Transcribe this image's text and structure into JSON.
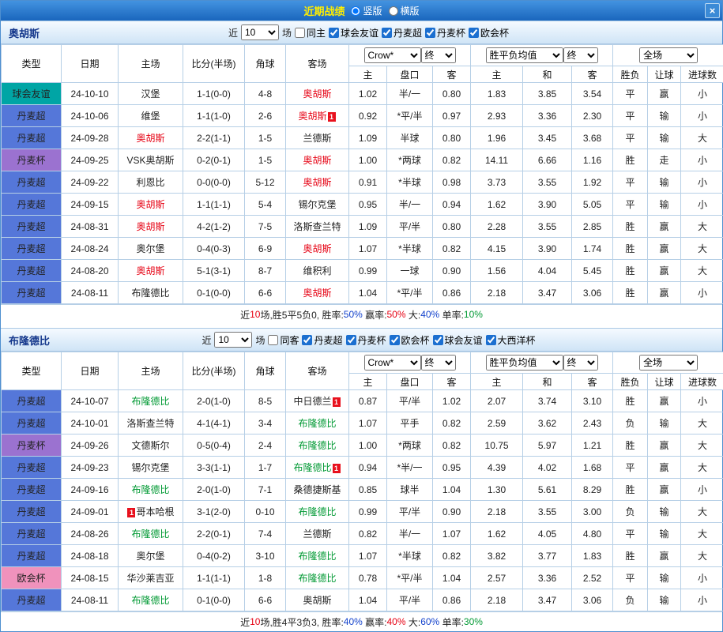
{
  "titlebar": {
    "title": "近期战绩",
    "options": [
      {
        "label": "竖版",
        "selected": true
      },
      {
        "label": "横版",
        "selected": false
      }
    ],
    "close": "×"
  },
  "table_header": {
    "main_cols": [
      "类型",
      "日期",
      "主场",
      "比分(半场)",
      "角球",
      "客场"
    ],
    "sub_cols": [
      "主",
      "盘口",
      "客",
      "主",
      "和",
      "客",
      "胜负",
      "让球",
      "进球数"
    ],
    "odds_company": "Crow*",
    "final_label": "终",
    "avg_label": "胜平负均值",
    "scope_label": "全场"
  },
  "value_colors": {
    "胜": "red",
    "平": "blue",
    "负": "green",
    "赢": "red",
    "输": "green",
    "走": "blue",
    "大": "red",
    "小": "green"
  },
  "league_colors": {
    "球会友谊": "#00a5a5",
    "丹麦超": "#5577d9",
    "丹麦杯": "#9b72d0",
    "欧会杯": "#f092bc",
    "大西洋杯": "#5577d9"
  },
  "sections": [
    {
      "team": "奥胡斯",
      "focus_color": "#e60012",
      "filter": {
        "near_label": "近",
        "count": "10",
        "games_label": "场",
        "same_label": "同主",
        "leagues": [
          "球会友谊",
          "丹麦超",
          "丹麦杯",
          "欧会杯"
        ]
      },
      "rows": [
        {
          "league": "球会友谊",
          "date": "24-10-10",
          "home": {
            "name": "汉堡"
          },
          "score": "1-1(0-0)",
          "corners": "4-8",
          "away": {
            "name": "奥胡斯",
            "focus": true
          },
          "odds": [
            "1.02",
            "半/一",
            "0.80"
          ],
          "avg": [
            "1.83",
            "3.85",
            "3.54"
          ],
          "result": "平",
          "handicap_result": "赢",
          "goals": "小"
        },
        {
          "league": "丹麦超",
          "date": "24-10-06",
          "home": {
            "name": "维堡"
          },
          "score": "1-1(1-0)",
          "corners": "2-6",
          "away": {
            "name": "奥胡斯",
            "focus": true,
            "badge": "1"
          },
          "odds": [
            "0.92",
            "*平/半",
            "0.97"
          ],
          "avg": [
            "2.93",
            "3.36",
            "2.30"
          ],
          "result": "平",
          "handicap_result": "输",
          "goals": "小"
        },
        {
          "league": "丹麦超",
          "date": "24-09-28",
          "home": {
            "name": "奥胡斯",
            "focus": true
          },
          "score": "2-2(1-1)",
          "corners": "1-5",
          "away": {
            "name": "兰德斯"
          },
          "odds": [
            "1.09",
            "半球",
            "0.80"
          ],
          "avg": [
            "1.96",
            "3.45",
            "3.68"
          ],
          "result": "平",
          "handicap_result": "输",
          "goals": "大"
        },
        {
          "league": "丹麦杯",
          "date": "24-09-25",
          "home": {
            "name": "VSK奥胡斯"
          },
          "score": "0-2(0-1)",
          "corners": "1-5",
          "away": {
            "name": "奥胡斯",
            "focus": true
          },
          "odds": [
            "1.00",
            "*两球",
            "0.82"
          ],
          "avg": [
            "14.11",
            "6.66",
            "1.16"
          ],
          "result": "胜",
          "handicap_result": "走",
          "goals": "小"
        },
        {
          "league": "丹麦超",
          "date": "24-09-22",
          "home": {
            "name": "利恩比"
          },
          "score": "0-0(0-0)",
          "corners": "5-12",
          "away": {
            "name": "奥胡斯",
            "focus": true
          },
          "odds": [
            "0.91",
            "*半球",
            "0.98"
          ],
          "avg": [
            "3.73",
            "3.55",
            "1.92"
          ],
          "result": "平",
          "handicap_result": "输",
          "goals": "小"
        },
        {
          "league": "丹麦超",
          "date": "24-09-15",
          "home": {
            "name": "奥胡斯",
            "focus": true
          },
          "score": "1-1(1-1)",
          "corners": "5-4",
          "away": {
            "name": "锡尔克堡"
          },
          "odds": [
            "0.95",
            "半/一",
            "0.94"
          ],
          "avg": [
            "1.62",
            "3.90",
            "5.05"
          ],
          "result": "平",
          "handicap_result": "输",
          "goals": "小"
        },
        {
          "league": "丹麦超",
          "date": "24-08-31",
          "home": {
            "name": "奥胡斯",
            "focus": true
          },
          "score": "4-2(1-2)",
          "corners": "7-5",
          "away": {
            "name": "洛斯查兰特"
          },
          "odds": [
            "1.09",
            "平/半",
            "0.80"
          ],
          "avg": [
            "2.28",
            "3.55",
            "2.85"
          ],
          "result": "胜",
          "handicap_result": "赢",
          "goals": "大"
        },
        {
          "league": "丹麦超",
          "date": "24-08-24",
          "home": {
            "name": "奥尔堡"
          },
          "score": "0-4(0-3)",
          "corners": "6-9",
          "away": {
            "name": "奥胡斯",
            "focus": true
          },
          "odds": [
            "1.07",
            "*半球",
            "0.82"
          ],
          "avg": [
            "4.15",
            "3.90",
            "1.74"
          ],
          "result": "胜",
          "handicap_result": "赢",
          "goals": "大"
        },
        {
          "league": "丹麦超",
          "date": "24-08-20",
          "home": {
            "name": "奥胡斯",
            "focus": true
          },
          "score": "5-1(3-1)",
          "corners": "8-7",
          "away": {
            "name": "维积利"
          },
          "odds": [
            "0.99",
            "一球",
            "0.90"
          ],
          "avg": [
            "1.56",
            "4.04",
            "5.45"
          ],
          "result": "胜",
          "handicap_result": "赢",
          "goals": "大"
        },
        {
          "league": "丹麦超",
          "date": "24-08-11",
          "home": {
            "name": "布隆德比"
          },
          "score": "0-1(0-0)",
          "corners": "6-6",
          "away": {
            "name": "奥胡斯",
            "focus": true
          },
          "odds": [
            "1.04",
            "*平/半",
            "0.86"
          ],
          "avg": [
            "2.18",
            "3.47",
            "3.06"
          ],
          "result": "胜",
          "handicap_result": "赢",
          "goals": "小"
        }
      ],
      "summary": [
        {
          "text": "近",
          "color": "black"
        },
        {
          "text": "10",
          "color": "red"
        },
        {
          "text": "场,胜5平5负0, 胜率:",
          "color": "black"
        },
        {
          "text": "50%",
          "color": "blue"
        },
        {
          "text": " 赢率:",
          "color": "black"
        },
        {
          "text": "50%",
          "color": "red"
        },
        {
          "text": " 大:",
          "color": "black"
        },
        {
          "text": "40%",
          "color": "blue"
        },
        {
          "text": " 单率:",
          "color": "black"
        },
        {
          "text": "10%",
          "color": "green"
        }
      ]
    },
    {
      "team": "布隆德比",
      "focus_color": "#009933",
      "filter": {
        "near_label": "近",
        "count": "10",
        "games_label": "场",
        "same_label": "同客",
        "leagues": [
          "丹麦超",
          "丹麦杯",
          "欧会杯",
          "球会友谊",
          "大西洋杯"
        ]
      },
      "rows": [
        {
          "league": "丹麦超",
          "date": "24-10-07",
          "home": {
            "name": "布隆德比",
            "focus": true
          },
          "score": "2-0(1-0)",
          "corners": "8-5",
          "away": {
            "name": "中日德兰",
            "badge": "1"
          },
          "odds": [
            "0.87",
            "平/半",
            "1.02"
          ],
          "avg": [
            "2.07",
            "3.74",
            "3.10"
          ],
          "result": "胜",
          "handicap_result": "赢",
          "goals": "小"
        },
        {
          "league": "丹麦超",
          "date": "24-10-01",
          "home": {
            "name": "洛斯查兰特"
          },
          "score": "4-1(4-1)",
          "corners": "3-4",
          "away": {
            "name": "布隆德比",
            "focus": true
          },
          "odds": [
            "1.07",
            "平手",
            "0.82"
          ],
          "avg": [
            "2.59",
            "3.62",
            "2.43"
          ],
          "result": "负",
          "handicap_result": "输",
          "goals": "大"
        },
        {
          "league": "丹麦杯",
          "date": "24-09-26",
          "home": {
            "name": "文德斯尔"
          },
          "score": "0-5(0-4)",
          "corners": "2-4",
          "away": {
            "name": "布隆德比",
            "focus": true
          },
          "odds": [
            "1.00",
            "*两球",
            "0.82"
          ],
          "avg": [
            "10.75",
            "5.97",
            "1.21"
          ],
          "result": "胜",
          "handicap_result": "赢",
          "goals": "大"
        },
        {
          "league": "丹麦超",
          "date": "24-09-23",
          "home": {
            "name": "锡尔克堡"
          },
          "score": "3-3(1-1)",
          "corners": "1-7",
          "away": {
            "name": "布隆德比",
            "focus": true,
            "badge": "1"
          },
          "odds": [
            "0.94",
            "*半/一",
            "0.95"
          ],
          "avg": [
            "4.39",
            "4.02",
            "1.68"
          ],
          "result": "平",
          "handicap_result": "赢",
          "goals": "大"
        },
        {
          "league": "丹麦超",
          "date": "24-09-16",
          "home": {
            "name": "布隆德比",
            "focus": true
          },
          "score": "2-0(1-0)",
          "corners": "7-1",
          "away": {
            "name": "桑德捷斯基"
          },
          "odds": [
            "0.85",
            "球半",
            "1.04"
          ],
          "avg": [
            "1.30",
            "5.61",
            "8.29"
          ],
          "result": "胜",
          "handicap_result": "赢",
          "goals": "小"
        },
        {
          "league": "丹麦超",
          "date": "24-09-01",
          "home": {
            "name": "哥本哈根",
            "badge": "1",
            "badge_pos": "before"
          },
          "score": "3-1(2-0)",
          "corners": "0-10",
          "away": {
            "name": "布隆德比",
            "focus": true
          },
          "odds": [
            "0.99",
            "平/半",
            "0.90"
          ],
          "avg": [
            "2.18",
            "3.55",
            "3.00"
          ],
          "result": "负",
          "handicap_result": "输",
          "goals": "大"
        },
        {
          "league": "丹麦超",
          "date": "24-08-26",
          "home": {
            "name": "布隆德比",
            "focus": true
          },
          "score": "2-2(0-1)",
          "corners": "7-4",
          "away": {
            "name": "兰德斯"
          },
          "odds": [
            "0.82",
            "半/一",
            "1.07"
          ],
          "avg": [
            "1.62",
            "4.05",
            "4.80"
          ],
          "result": "平",
          "handicap_result": "输",
          "goals": "大"
        },
        {
          "league": "丹麦超",
          "date": "24-08-18",
          "home": {
            "name": "奥尔堡"
          },
          "score": "0-4(0-2)",
          "corners": "3-10",
          "away": {
            "name": "布隆德比",
            "focus": true
          },
          "odds": [
            "1.07",
            "*半球",
            "0.82"
          ],
          "avg": [
            "3.82",
            "3.77",
            "1.83"
          ],
          "result": "胜",
          "handicap_result": "赢",
          "goals": "大"
        },
        {
          "league": "欧会杯",
          "date": "24-08-15",
          "home": {
            "name": "华沙莱吉亚"
          },
          "score": "1-1(1-1)",
          "corners": "1-8",
          "away": {
            "name": "布隆德比",
            "focus": true
          },
          "odds": [
            "0.78",
            "*平/半",
            "1.04"
          ],
          "avg": [
            "2.57",
            "3.36",
            "2.52"
          ],
          "result": "平",
          "handicap_result": "输",
          "goals": "小"
        },
        {
          "league": "丹麦超",
          "date": "24-08-11",
          "home": {
            "name": "布隆德比",
            "focus": true
          },
          "score": "0-1(0-0)",
          "corners": "6-6",
          "away": {
            "name": "奥胡斯"
          },
          "odds": [
            "1.04",
            "平/半",
            "0.86"
          ],
          "avg": [
            "2.18",
            "3.47",
            "3.06"
          ],
          "result": "负",
          "handicap_result": "输",
          "goals": "小"
        }
      ],
      "summary": [
        {
          "text": "近",
          "color": "black"
        },
        {
          "text": "10",
          "color": "red"
        },
        {
          "text": "场,胜4平3负3, 胜率:",
          "color": "black"
        },
        {
          "text": "40%",
          "color": "blue"
        },
        {
          "text": " 赢率:",
          "color": "black"
        },
        {
          "text": "40%",
          "color": "red"
        },
        {
          "text": " 大:",
          "color": "black"
        },
        {
          "text": "60%",
          "color": "blue"
        },
        {
          "text": " 单率:",
          "color": "black"
        },
        {
          "text": "30%",
          "color": "green"
        }
      ]
    }
  ]
}
